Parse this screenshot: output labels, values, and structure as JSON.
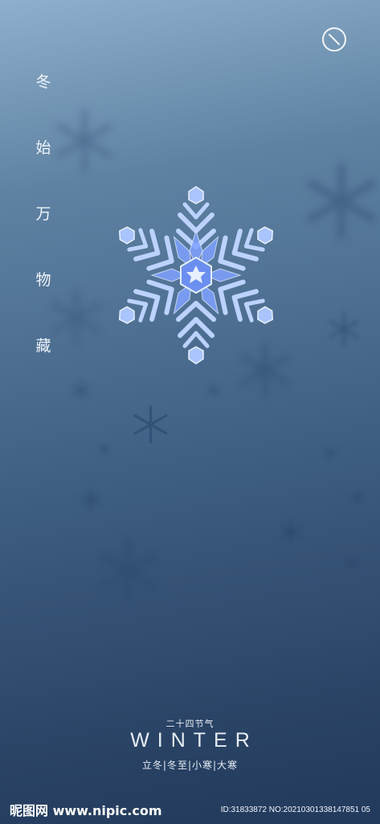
{
  "vertical_text": [
    "冬",
    "始",
    "万",
    "物",
    "藏"
  ],
  "solar_terms_label": "二十四节气",
  "title": "WINTER",
  "terms_line": "立冬|冬至|小寒|大寒",
  "footer": {
    "logo": "昵图网 www.nipic.com",
    "id_text": "ID:31833872 NO:20210301338147851 05"
  },
  "icons": [
    "no-entry-icon",
    "snowflake-icon"
  ],
  "colors": {
    "top": "#8fb0cc",
    "bottom": "#223a5c",
    "flake": "#cfe0ff"
  }
}
